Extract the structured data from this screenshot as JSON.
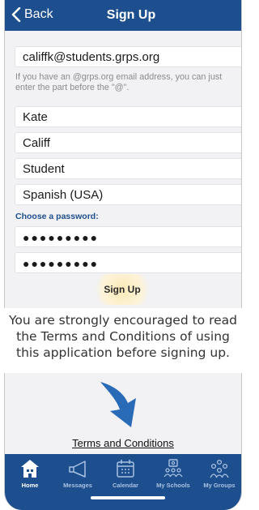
{
  "navbar": {
    "back_label": "Back",
    "title": "Sign Up"
  },
  "form": {
    "email_value": "califfk@students.grps.org",
    "email_hint": "If you have an @grps.org email address, you can just enter the part before the \"@\".",
    "first_name": "Kate",
    "last_name": "Califf",
    "role": "Student",
    "language": "Spanish (USA)",
    "password_label": "Choose a password:",
    "password_masked": "●●●●●●●●●",
    "confirm_password_masked": "●●●●●●●●●",
    "submit_label": "Sign Up"
  },
  "notice": {
    "line1": "You are strongly encouraged to read",
    "line2": "the Terms and Conditions of using",
    "line3": "this application before signing up."
  },
  "terms_link": "Terms and Conditions",
  "tabbar": {
    "items": [
      {
        "label": "Home",
        "icon": "home-icon",
        "active": true
      },
      {
        "label": "Messages",
        "icon": "megaphone-icon",
        "active": false
      },
      {
        "label": "Calendar",
        "icon": "calendar-icon",
        "active": false
      },
      {
        "label": "My Schools",
        "icon": "school-group-icon",
        "active": false
      },
      {
        "label": "My Groups",
        "icon": "groups-icon",
        "active": false
      }
    ]
  },
  "colors": {
    "brand_blue": "#1d4f8e",
    "link_blue": "#1d4f8e",
    "arrow_blue": "#2a6bb8"
  }
}
